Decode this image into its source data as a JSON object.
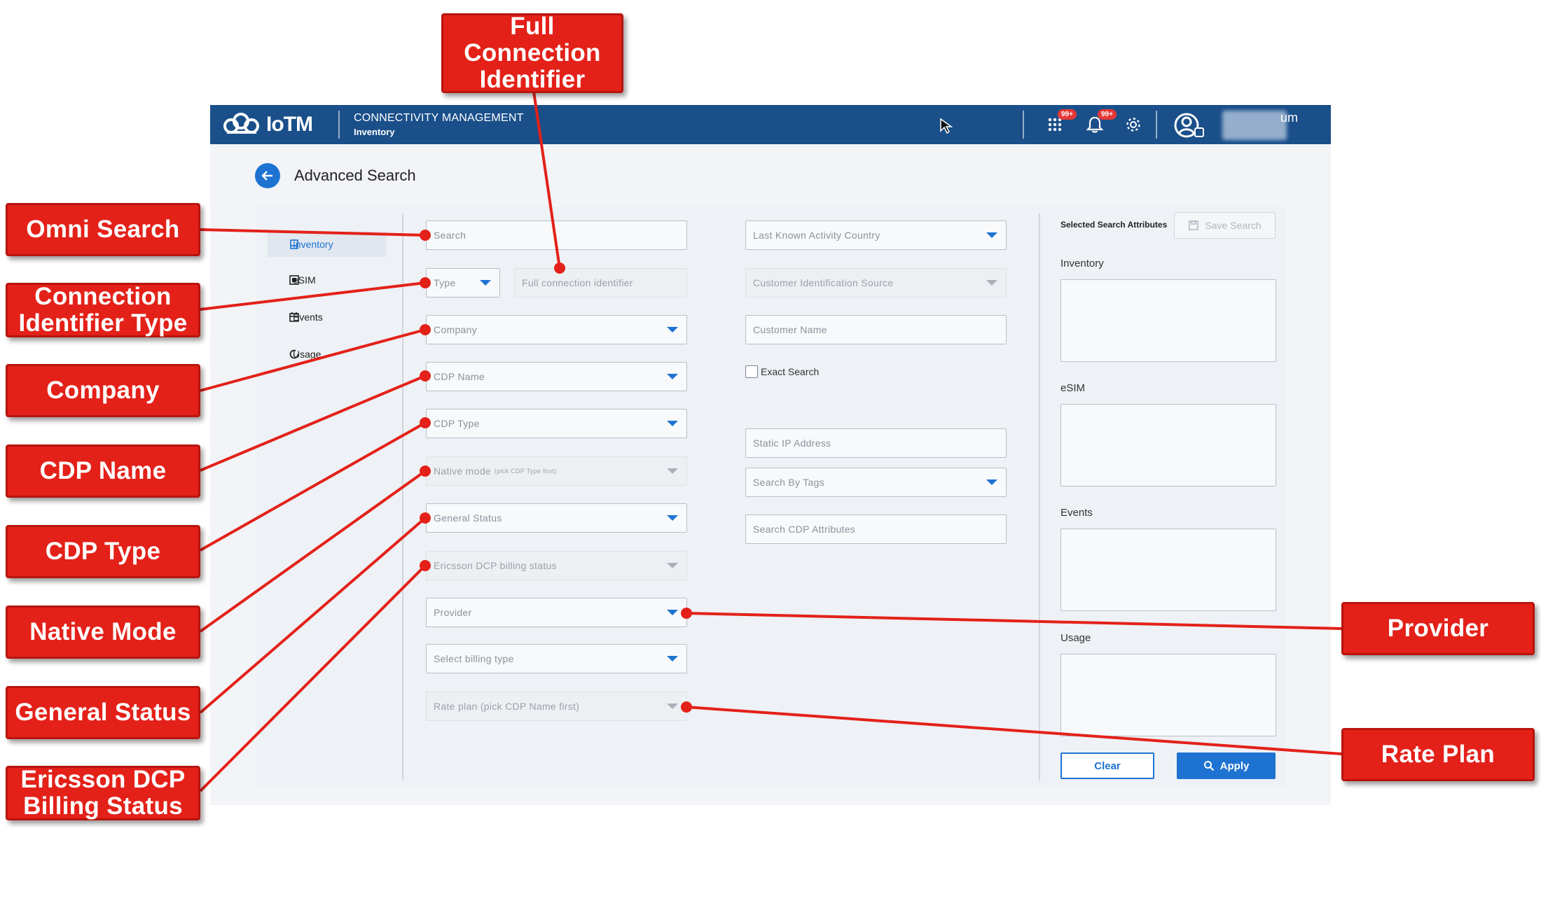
{
  "app": {
    "logo_text": "IoTM",
    "context_title": "CONNECTIVITY MANAGEMENT",
    "context_subtitle": "Inventory",
    "apps_badge": "99+",
    "notifications_badge": "99+",
    "user_name_partial": "um"
  },
  "page": {
    "title": "Advanced Search"
  },
  "nav": {
    "items": [
      {
        "label": "Inventory",
        "active": true
      },
      {
        "label": "eSIM"
      },
      {
        "label": "Events"
      },
      {
        "label": "Usage"
      }
    ]
  },
  "form": {
    "search_placeholder": "Search",
    "type_placeholder": "Type",
    "full_connection_identifier_placeholder": "Full connection identifier",
    "company_placeholder": "Company",
    "cdp_name_placeholder": "CDP Name",
    "cdp_type_placeholder": "CDP Type",
    "native_mode_placeholder": "Native mode",
    "native_mode_hint": "(pick CDP Type first)",
    "general_status_placeholder": "General Status",
    "ericsson_billing_placeholder": "Ericsson DCP billing status",
    "provider_placeholder": "Provider",
    "billing_type_placeholder": "Select billing type",
    "rate_plan_placeholder": "Rate plan (pick CDP Name first)",
    "last_known_country_placeholder": "Last Known Activity Country",
    "customer_id_source_placeholder": "Customer Identification Source",
    "customer_name_placeholder": "Customer Name",
    "exact_search_label": "Exact Search",
    "static_ip_placeholder": "Static IP Address",
    "search_by_tags_placeholder": "Search By Tags",
    "cdp_attributes_placeholder": "Search CDP Attributes"
  },
  "selected": {
    "header": "Selected Search Attributes",
    "save_label": "Save Search",
    "sections": [
      "Inventory",
      "eSIM",
      "Events",
      "Usage"
    ],
    "clear_label": "Clear",
    "apply_label": "Apply"
  },
  "annotations": {
    "full_connection_identifier": "Full\nConnection\nIdentifier",
    "omni_search": "Omni Search",
    "connection_identifier_type": "Connection\nIdentifier Type",
    "company": "Company",
    "cdp_name": "CDP Name",
    "cdp_type": "CDP Type",
    "native_mode": "Native Mode",
    "general_status": "General Status",
    "ericsson_dcp_billing_status": "Ericsson DCP\nBilling Status",
    "provider": "Provider",
    "rate_plan": "Rate Plan"
  },
  "colors": {
    "topbar": "#1a4f8a",
    "accent": "#1e73d2",
    "callout": "#e32119",
    "badge": "#e53935"
  },
  "icons": [
    "cloud-logo-icon",
    "apps-grid-icon",
    "bell-icon",
    "gear-icon",
    "user-avatar-icon",
    "cursor-icon",
    "back-arrow-icon",
    "search-icon",
    "save-icon"
  ]
}
